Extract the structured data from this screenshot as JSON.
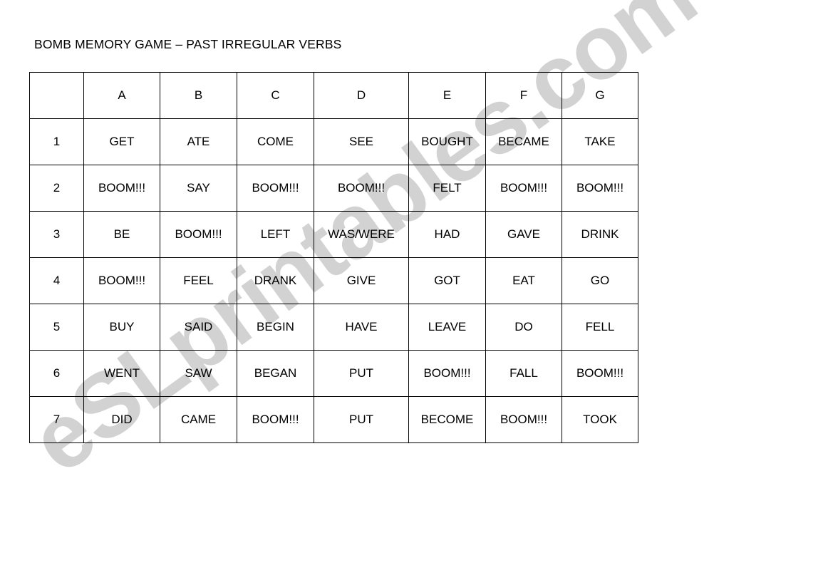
{
  "document": {
    "title": "BOMB MEMORY GAME – PAST IRREGULAR VERBS",
    "watermark": "eSLprintables.com",
    "watermark_color": "#d2d2d2",
    "page_background": "#ffffff",
    "text_color": "#000000",
    "border_color": "#000000"
  },
  "grid": {
    "corner_label": "",
    "column_headers": [
      "A",
      "B",
      "C",
      "D",
      "E",
      "F",
      "G"
    ],
    "row_labels": [
      "1",
      "2",
      "3",
      "4",
      "5",
      "6",
      "7"
    ],
    "bomb_label": "BOOM!!!",
    "rows": [
      {
        "label": "1",
        "cells": [
          "GET",
          "ATE",
          "COME",
          "SEE",
          "BOUGHT",
          "BECAME",
          "TAKE"
        ]
      },
      {
        "label": "2",
        "cells": [
          "BOOM!!!",
          "SAY",
          "BOOM!!!",
          "BOOM!!!",
          "FELT",
          "BOOM!!!",
          "BOOM!!!"
        ]
      },
      {
        "label": "3",
        "cells": [
          "BE",
          "BOOM!!!",
          "LEFT",
          "WAS/WERE",
          "HAD",
          "GAVE",
          "DRINK"
        ]
      },
      {
        "label": "4",
        "cells": [
          "BOOM!!!",
          "FEEL",
          "DRANK",
          "GIVE",
          "GOT",
          "EAT",
          "GO"
        ]
      },
      {
        "label": "5",
        "cells": [
          "BUY",
          "SAID",
          "BEGIN",
          "HAVE",
          "LEAVE",
          "DO",
          "FELL"
        ]
      },
      {
        "label": "6",
        "cells": [
          "WENT",
          "SAW",
          "BEGAN",
          "PUT",
          "BOOM!!!",
          "FALL",
          "BOOM!!!"
        ]
      },
      {
        "label": "7",
        "cells": [
          "DID",
          "CAME",
          "BOOM!!!",
          "PUT",
          "BECOME",
          "BOOM!!!",
          "TOOK"
        ]
      }
    ]
  }
}
